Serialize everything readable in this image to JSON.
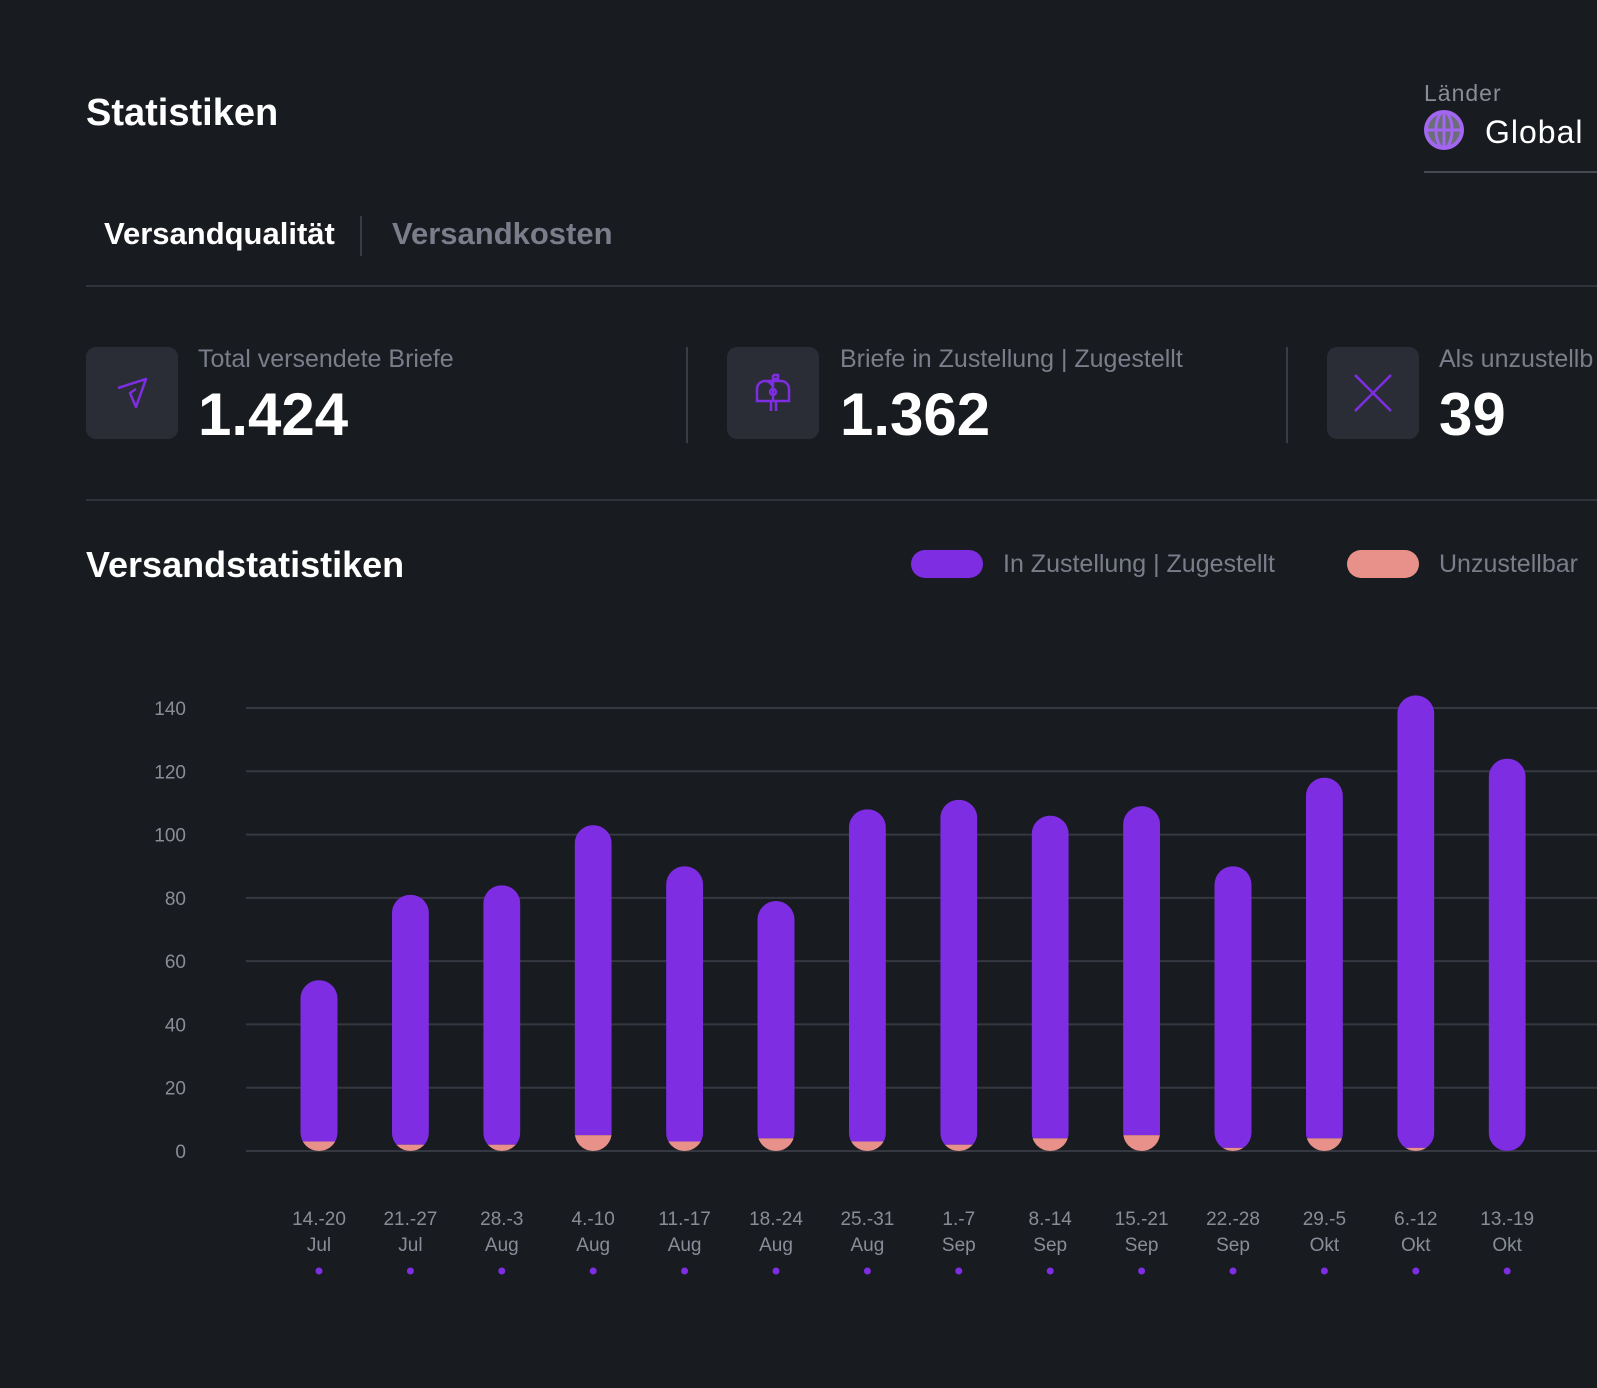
{
  "header": {
    "title": "Statistiken",
    "country_label": "Länder",
    "country_value": "Global",
    "globe_icon": "globe-icon"
  },
  "tabs": [
    {
      "label": "Versandqualität",
      "active": true
    },
    {
      "label": "Versandkosten",
      "active": false
    }
  ],
  "cards": [
    {
      "label": "Total versendete Briefe",
      "value": "1.424",
      "icon": "send-icon"
    },
    {
      "label": "Briefe in Zustellung | Zugestellt",
      "value": "1.362",
      "icon": "mailbox-icon"
    },
    {
      "label": "Als unzustellb",
      "value": "39",
      "icon": "x-icon"
    }
  ],
  "section_title": "Versandstatistiken",
  "colors": {
    "accent": "#7e2de3",
    "undeliverable": "#e8918a",
    "background": "#181b20"
  },
  "chart_data": {
    "type": "bar",
    "stacked": true,
    "ylim": [
      0,
      140
    ],
    "yticks": [
      "0",
      "20",
      "40",
      "60",
      "80",
      "100",
      "120",
      "140"
    ],
    "grid": true,
    "legend_position": "top-right",
    "categories": [
      [
        "14.-20",
        "Jul"
      ],
      [
        "21.-27",
        "Jul"
      ],
      [
        "28.-3",
        "Aug"
      ],
      [
        "4.-10",
        "Aug"
      ],
      [
        "11.-17",
        "Aug"
      ],
      [
        "18.-24",
        "Aug"
      ],
      [
        "25.-31",
        "Aug"
      ],
      [
        "1.-7",
        "Sep"
      ],
      [
        "8.-14",
        "Sep"
      ],
      [
        "15.-21",
        "Sep"
      ],
      [
        "22.-28",
        "Sep"
      ],
      [
        "29.-5",
        "Okt"
      ],
      [
        "6.-12",
        "Okt"
      ],
      [
        "13.-19",
        "Okt"
      ]
    ],
    "series": [
      {
        "name": "In Zustellung | Zugestellt",
        "color": "#7e2de3",
        "values": [
          51,
          79,
          82,
          98,
          87,
          75,
          105,
          109,
          102,
          104,
          89,
          114,
          143,
          124
        ]
      },
      {
        "name": "Unzustellbar",
        "color": "#e8918a",
        "values": [
          3,
          2,
          2,
          5,
          3,
          4,
          3,
          2,
          4,
          5,
          1,
          4,
          1,
          0
        ]
      }
    ]
  }
}
